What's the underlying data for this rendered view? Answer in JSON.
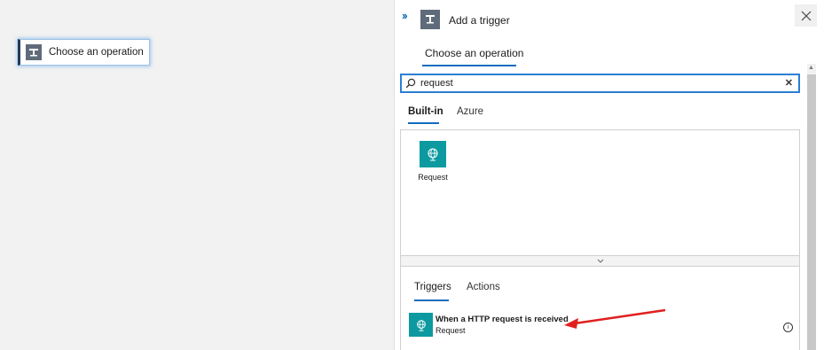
{
  "canvas": {
    "node_label": "Choose an operation",
    "node_icon": "trigger-icon"
  },
  "panel": {
    "expand_icon": "double-chevron-right-icon",
    "title": "Add a trigger",
    "title_icon": "trigger-icon",
    "close_icon": "close-icon",
    "main_tab": "Choose an operation",
    "search": {
      "value": "request",
      "icon": "search-icon",
      "clear_icon": "clear-icon"
    },
    "source_tabs": [
      {
        "label": "Built-in",
        "active": true
      },
      {
        "label": "Azure",
        "active": false
      }
    ],
    "connectors": [
      {
        "label": "Request",
        "icon": "globe-icon"
      }
    ],
    "collapse_icon": "chevron-down-icon",
    "result_tabs": [
      {
        "label": "Triggers",
        "active": true
      },
      {
        "label": "Actions",
        "active": false
      }
    ],
    "results": [
      {
        "title": "When a HTTP request is received",
        "subtitle": "Request",
        "icon": "globe-icon",
        "info_icon": "info-icon"
      }
    ]
  },
  "colors": {
    "accent": "#0f6cbd",
    "teal": "#0c9aa0",
    "annotation": "#e02020"
  }
}
